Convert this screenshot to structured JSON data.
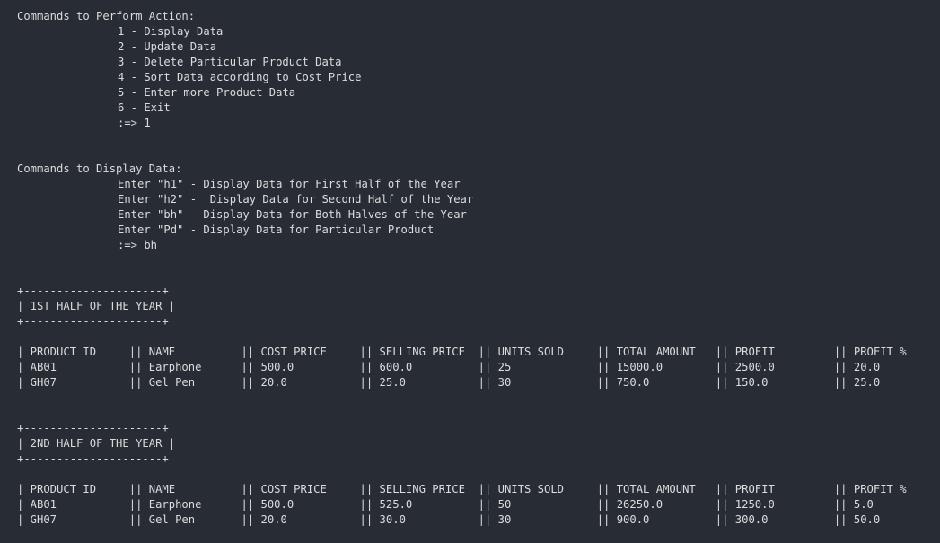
{
  "actions": {
    "header": "Commands to Perform Action:",
    "items": [
      "1 - Display Data",
      "2 - Update Data",
      "3 - Delete Particular Product Data",
      "4 - Sort Data according to Cost Price",
      "5 - Enter more Product Data",
      "6 - Exit"
    ],
    "prompt": ":=> 1"
  },
  "display": {
    "header": "Commands to Display Data:",
    "items": [
      "Enter \"h1\" - Display Data for First Half of the Year",
      "Enter \"h2\" -  Display Data for Second Half of the Year",
      "Enter \"bh\" - Display Data for Both Halves of the Year",
      "Enter \"Pd\" - Display Data for Particular Product"
    ],
    "prompt": ":=> bh"
  },
  "half1": {
    "border": "+---------------------+",
    "title_line": "| 1ST HALF OF THE YEAR |",
    "header_row": "| PRODUCT ID     || NAME          || COST PRICE     || SELLING PRICE  || UNITS SOLD     || TOTAL AMOUNT   || PROFIT         || PROFIT %       |",
    "rows": [
      "| AB01           || Earphone      || 500.0          || 600.0          || 25             || 15000.0        || 2500.0         || 20.0           |",
      "| GH07           || Gel Pen       || 20.0           || 25.0           || 30             || 750.0          || 150.0          || 25.0           |"
    ]
  },
  "half2": {
    "border": "+---------------------+",
    "title_line": "| 2ND HALF OF THE YEAR |",
    "header_row": "| PRODUCT ID     || NAME          || COST PRICE     || SELLING PRICE  || UNITS SOLD     || TOTAL AMOUNT   || PROFIT         || PROFIT %       |",
    "rows": [
      "| AB01           || Earphone      || 500.0          || 525.0          || 50             || 26250.0        || 1250.0         || 5.0            |",
      "| GH07           || Gel Pen       || 20.0           || 30.0           || 30             || 900.0          || 300.0          || 50.0           |"
    ]
  }
}
